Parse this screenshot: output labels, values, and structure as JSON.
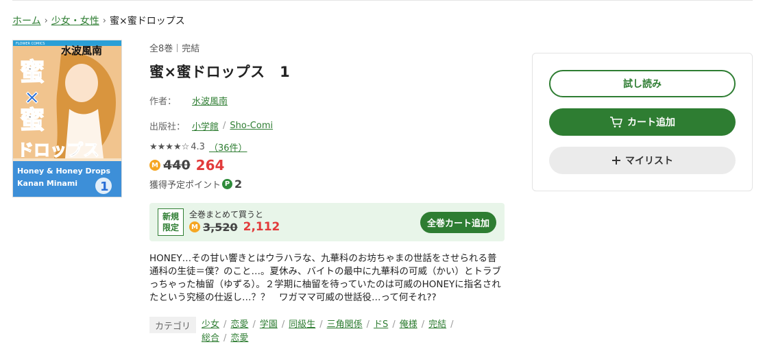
{
  "breadcrumb": {
    "home": "ホーム",
    "category": "少女・女性",
    "current": "蜜×蜜ドロップス"
  },
  "cover": {
    "label": "FLOWER COMICS",
    "author": "水波風南",
    "title_chars": [
      "蜜",
      "×",
      "蜜",
      "ドロップス"
    ],
    "en_title_1": "Honey & Honey Drops",
    "en_title_2": "Kanan Minami",
    "volume": "1"
  },
  "book": {
    "volumes": "全8巻",
    "status": "完結",
    "title": "蜜×蜜ドロップス　1",
    "author_label": "作者：",
    "author": "水波風南",
    "publisher_label": "出版社：",
    "publisher": "小学館",
    "label": "Sho-Comi"
  },
  "rating": {
    "stars": "★★★★☆",
    "score": "4.3",
    "count": "（36件）"
  },
  "price": {
    "coin_icon": "M",
    "original": "440",
    "sale": "264",
    "points_label": "獲得予定ポイント",
    "points_icon": "P",
    "points": "2"
  },
  "bundle": {
    "badge_line1": "新規",
    "badge_line2": "限定",
    "text": "全巻まとめて買うと",
    "original": "3,520",
    "sale": "2,112",
    "button": "全巻カート追加"
  },
  "description": "HONEY…その甘い響きとはウラハラな、九華科のお坊ちゃまの世話をさせられる普通科の生徒＝僕？のこと…。夏休み、バイトの最中に九華科の可威（かい）とトラブっちゃった柚留（ゆずる）。２学期に柚留を待っていたのは可威のHONEYに指名されたという究極の仕返し…？？　ワガママ可威の世話役…って何それ??",
  "categories": {
    "label": "カテゴリ",
    "items": [
      "少女",
      "恋愛",
      "学園",
      "同級生",
      "三角関係",
      "ドS",
      "俺様",
      "完結",
      "総合",
      "恋愛"
    ]
  },
  "actions": {
    "trial": "試し読み",
    "cart": "カート追加",
    "mylist": "マイリスト"
  },
  "colors": {
    "brand_green": "#2e7d32",
    "sale_red": "#e23b3b",
    "coin": "#f5a623",
    "bundle_bg": "#e8f5e9"
  }
}
